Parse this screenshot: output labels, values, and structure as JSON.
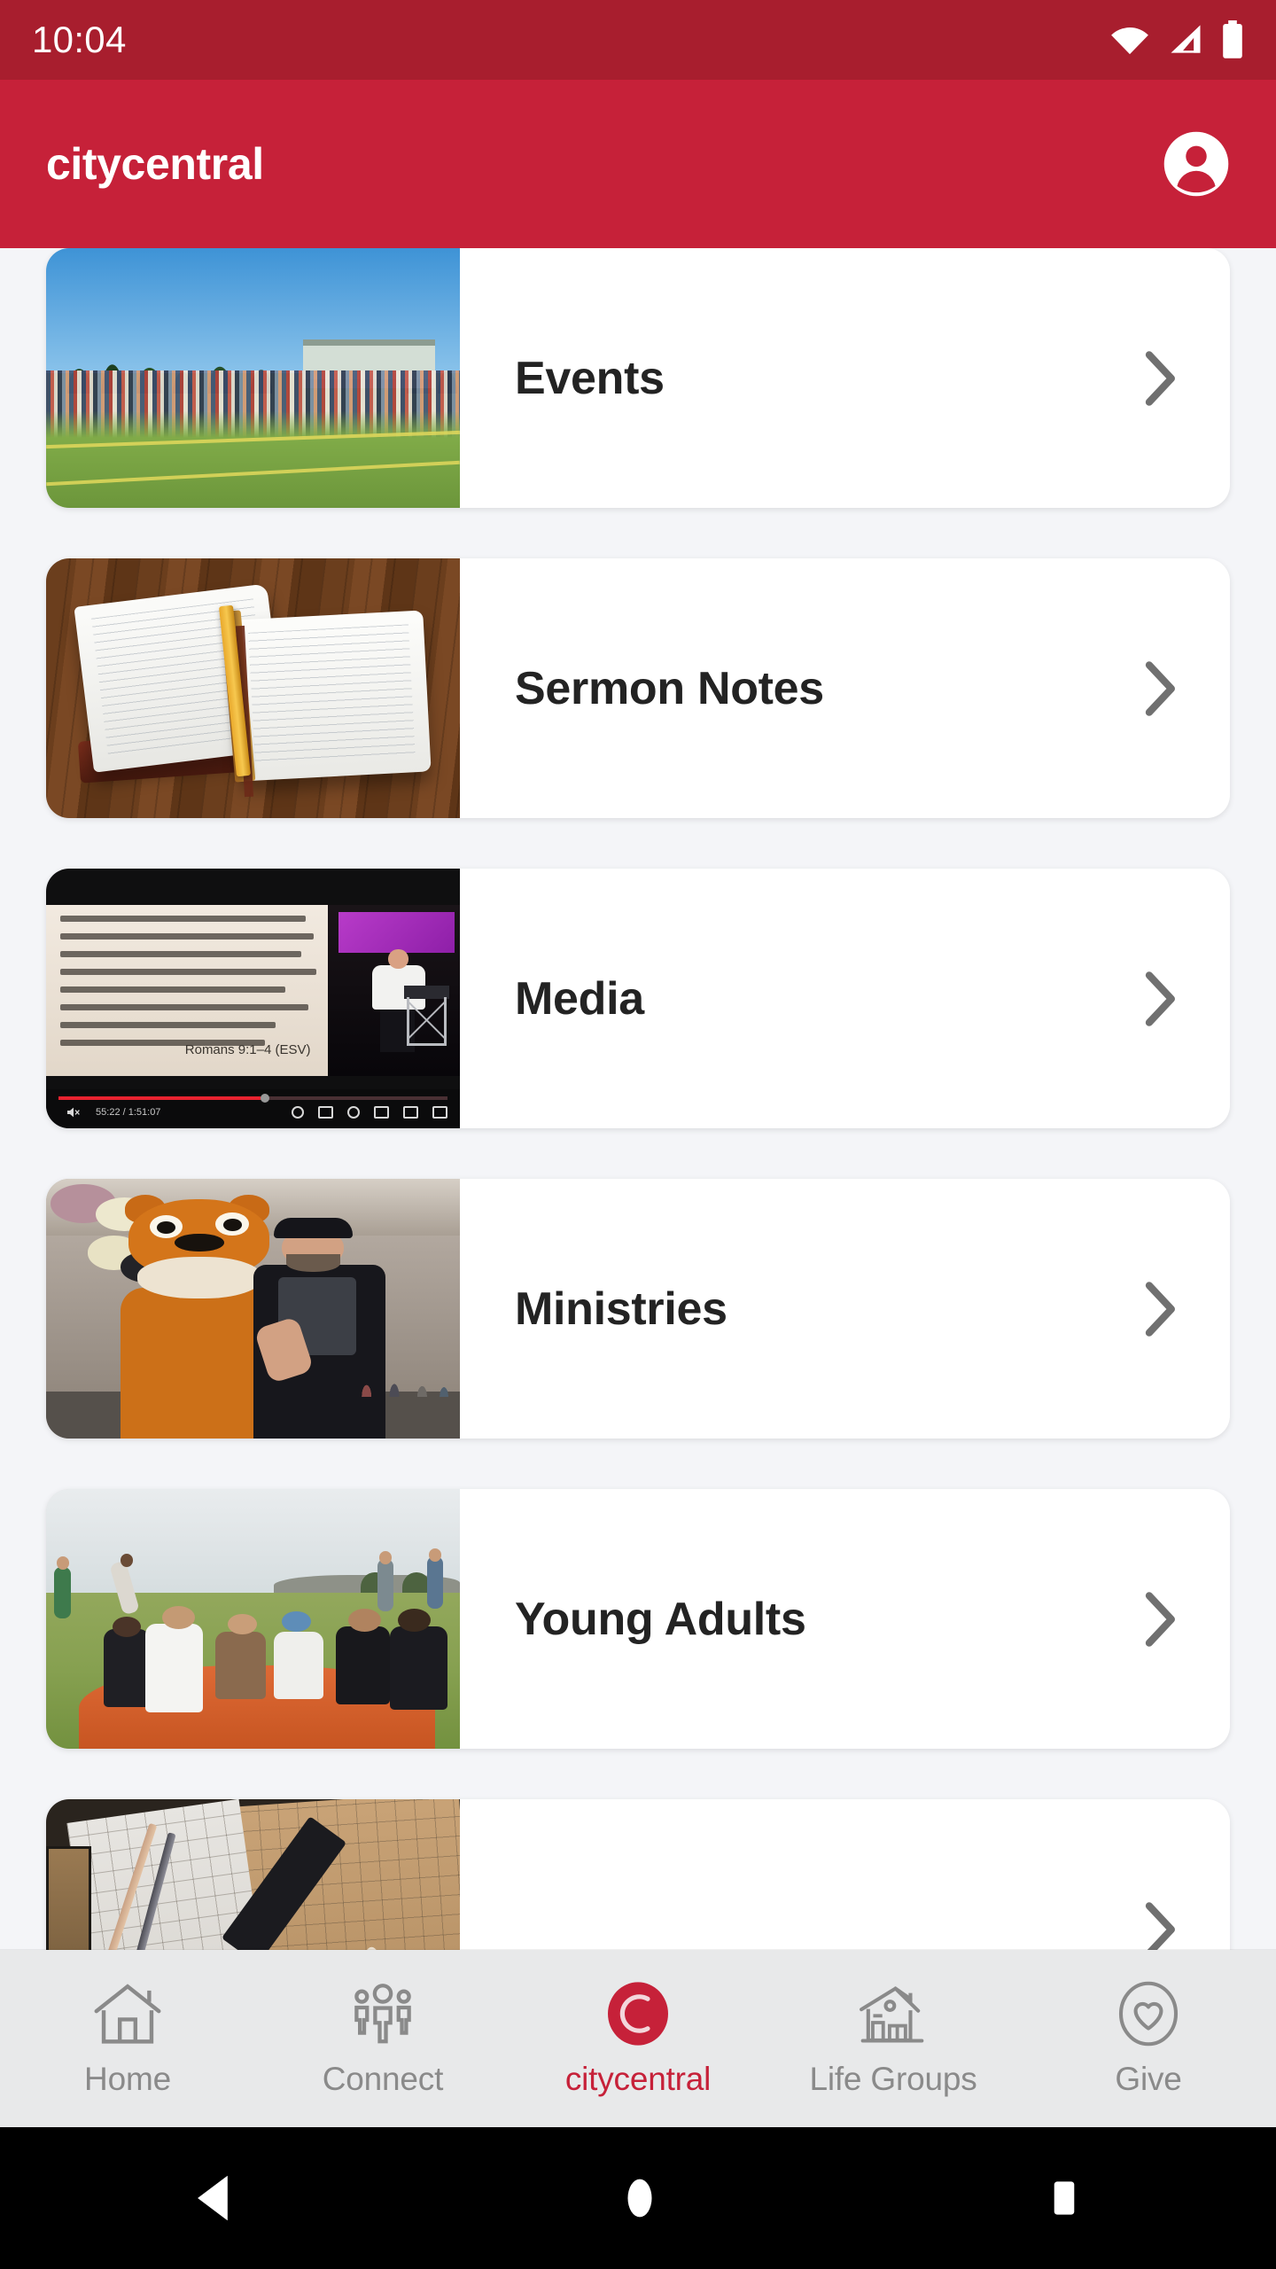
{
  "status_bar": {
    "time": "10:04",
    "icons": [
      "wifi-icon",
      "cellular-signal-icon",
      "battery-icon"
    ],
    "background": "#A81E2E"
  },
  "app_bar": {
    "title": "citycentral",
    "account_icon": "account-circle-icon",
    "background": "#C62139"
  },
  "theme": {
    "brand_red": "#C62139",
    "status_red": "#A81E2E",
    "page_background": "#F4F5F8",
    "card_background": "#FFFFFF",
    "label_color": "#232323",
    "chevron_color": "#707070",
    "tabbar_background": "#E8E9EA",
    "tab_inactive_color": "#8A8A8A"
  },
  "main": {
    "cards": [
      {
        "label": "Events",
        "chevron": "chevron-right-icon",
        "thumbnail": "outdoor-church-event-crowd-on-grass-field"
      },
      {
        "label": "Sermon Notes",
        "chevron": "chevron-right-icon",
        "thumbnail": "open-notebook-with-yellow-pencil-on-wooden-table"
      },
      {
        "label": "Media",
        "chevron": "chevron-right-icon",
        "thumbnail": "youtube-sermon-video-player",
        "video": {
          "slide_lines": [
            "am speaking the truth in Christ—I am not lying; my",
            "nscience bears me witness in the Holy Spirit— 2 that I",
            "ve great sorrow and unceasing anguish in my heart.",
            "or I could wish that I myself were accursed and cut off",
            "m Christ for the sake of my brothers, my kinsmen",
            "cording to the flesh. 4 They are Israelites, and to them",
            "long the adoption, the glory, the covenants, the",
            "ring of the law, the worship, and the promises."
          ],
          "scripture_reference": "Romans 9:1–4 (ESV)",
          "timestamp": "55:22 / 1:51:07",
          "progress_percent": 52,
          "controls": [
            "mute-icon",
            "volume-slider",
            "captions-icon",
            "settings-icon",
            "miniplayer-icon",
            "theater-icon",
            "fullscreen-icon"
          ]
        }
      },
      {
        "label": "Ministries",
        "chevron": "chevron-right-icon",
        "thumbnail": "lion-mascot-with-man-at-indoor-event"
      },
      {
        "label": "Young Adults",
        "chevron": "chevron-right-icon",
        "thumbnail": "young-adults-sitting-on-orange-blanket-in-park"
      },
      {
        "label": "",
        "chevron": "chevron-right-icon",
        "thumbnail": "blueprints-with-pencils-and-rulers"
      }
    ]
  },
  "tab_bar": {
    "tabs": [
      {
        "label": "Home",
        "icon": "home-icon",
        "active": false
      },
      {
        "label": "Connect",
        "icon": "people-group-icon",
        "active": false
      },
      {
        "label": "citycentral",
        "icon": "citycentral-logo-icon",
        "active": true
      },
      {
        "label": "Life Groups",
        "icon": "house-barn-icon",
        "active": false
      },
      {
        "label": "Give",
        "icon": "heart-circle-icon",
        "active": false
      }
    ]
  },
  "android_nav": {
    "buttons": [
      {
        "name": "back-button",
        "icon": "triangle-left-icon"
      },
      {
        "name": "home-button",
        "icon": "circle-icon"
      },
      {
        "name": "recents-button",
        "icon": "square-icon"
      }
    ]
  }
}
